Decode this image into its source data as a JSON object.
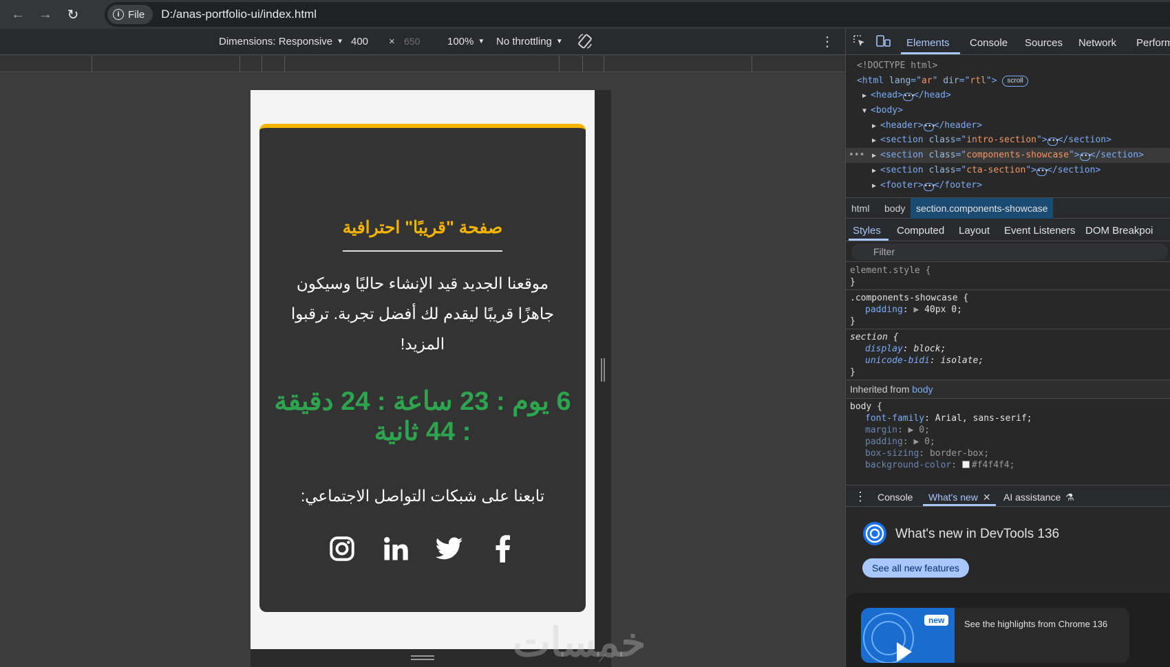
{
  "browser": {
    "file_label": "File",
    "url": "D:/anas-portfolio-ui/index.html"
  },
  "device_toolbar": {
    "dimensions_label": "Dimensions: Responsive",
    "width": "400",
    "times": "×",
    "height": "650",
    "zoom": "100%",
    "throttling": "No throttling"
  },
  "page": {
    "title": "صفحة \"قريبًا\" احترافية",
    "description": "موقعنا الجديد قيد الإنشاء حاليًا وسيكون جاهزًا قريبًا ليقدم لك أفضل تجربة. ترقبوا المزيد!",
    "countdown": "6 يوم : 23 ساعة : 24 دقيقة : 44 ثانية",
    "follow_text": "تابعنا على شبكات التواصل الاجتماعي:",
    "socials": [
      "facebook-icon",
      "twitter-icon",
      "linkedin-icon",
      "instagram-icon"
    ],
    "accent_color": "#f5b400",
    "countdown_color": "#2ea44f",
    "card_bg": "#333333"
  },
  "watermark": "خمسات",
  "devtools": {
    "tabs": [
      "Elements",
      "Console",
      "Sources",
      "Network",
      "Perform"
    ],
    "active_tab": "Elements",
    "dom": {
      "doctype": "<!DOCTYPE html>",
      "html_attr_lang": "ar",
      "html_attr_dir": "rtl",
      "scroll_badge": "scroll",
      "head": "head",
      "body": "body",
      "header": "header",
      "section_intro": "intro-section",
      "section_showcase": "components-showcase",
      "section_cta": "cta-section",
      "footer": "footer"
    },
    "breadcrumbs": [
      "html",
      "body",
      "section.components-showcase"
    ],
    "sub_tabs": [
      "Styles",
      "Computed",
      "Layout",
      "Event Listeners",
      "DOM Breakpoi"
    ],
    "filter_placeholder": "Filter",
    "styles": {
      "element_style": "element.style {",
      "showcase_selector": ".components-showcase {",
      "padding_prop": "padding",
      "padding_val": "40px 0;",
      "section_selector": "section {",
      "display_prop": "display",
      "display_val": "block;",
      "unicode_prop": "unicode-bidi",
      "unicode_val": "isolate;",
      "inherited_label": "Inherited from",
      "inherited_from": "body",
      "body_selector": "body {",
      "font_prop": "font-family",
      "font_val": "Arial, sans-serif;",
      "margin_prop": "margin",
      "margin_val": "0;",
      "padding2_val": "0;",
      "boxsizing_prop": "box-sizing",
      "boxsizing_val": "border-box;",
      "bg_prop": "background-color",
      "bg_val": "#f4f4f4;",
      "close_brace": "}"
    },
    "drawer_tabs": [
      "Console",
      "What's new",
      "AI assistance"
    ],
    "whats_new": {
      "title": "What's new in DevTools 136",
      "button": "See all new features",
      "new_badge": "new",
      "caption": "See the highlights from Chrome 136"
    }
  }
}
